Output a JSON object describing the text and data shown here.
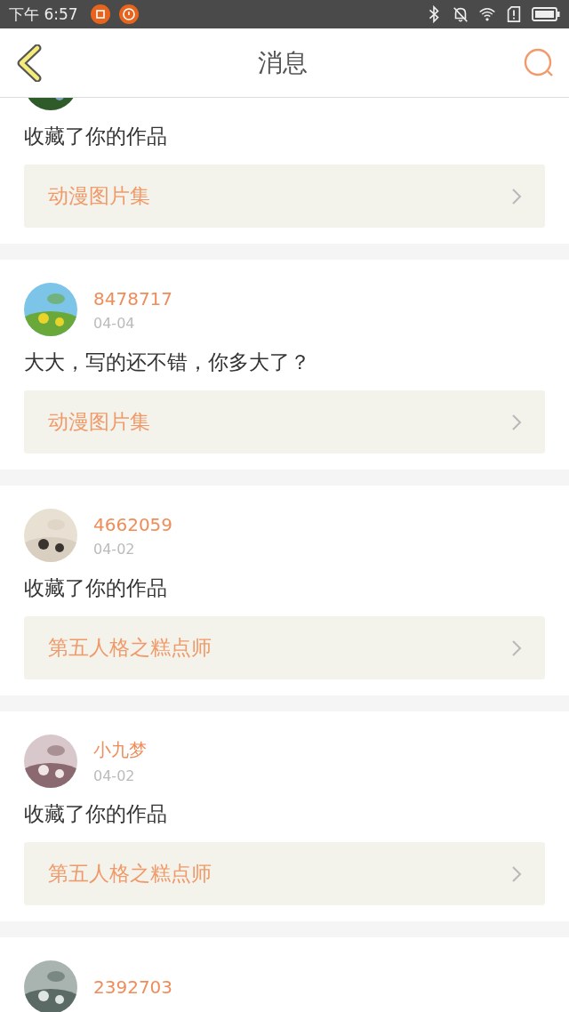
{
  "status_bar": {
    "time": "下午 6:57"
  },
  "header": {
    "title": "消息"
  },
  "messages": [
    {
      "message": "收藏了你的作品",
      "work": "动漫图片集"
    },
    {
      "name": "8478717",
      "date": "04-04",
      "message": "大大，写的还不错，你多大了？",
      "work": "动漫图片集"
    },
    {
      "name": "4662059",
      "date": "04-02",
      "message": "收藏了你的作品",
      "work": "第五人格之糕点师"
    },
    {
      "name": "小九梦",
      "date": "04-02",
      "message": "收藏了你的作品",
      "work": "第五人格之糕点师"
    },
    {
      "name": "2392703"
    }
  ]
}
